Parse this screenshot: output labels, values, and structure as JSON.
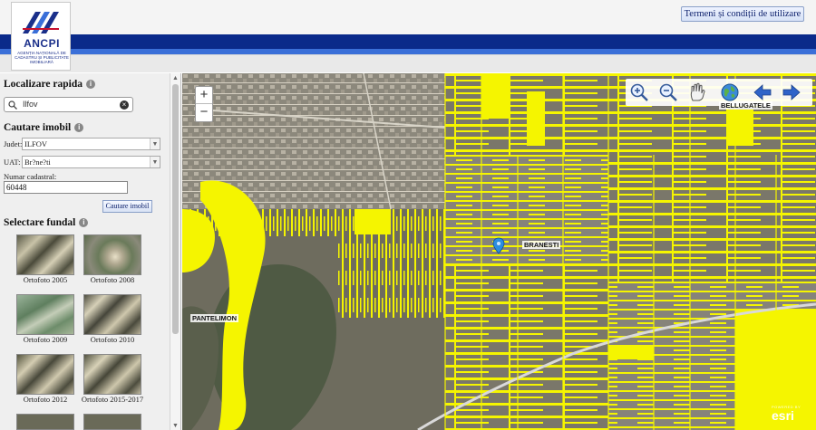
{
  "header": {
    "logo_name": "ANCPI",
    "logo_sub": "AGENȚIA NAȚIONALĂ DE CADASTRU ȘI PUBLICITATE IMOBILIARĂ",
    "terms_label": "Termeni și condiții de utilizare",
    "colors": {
      "band_dark": "#0a2a8a",
      "band_light": "#3a6fd8"
    }
  },
  "sidebar": {
    "quick_locate": {
      "title": "Localizare rapida",
      "search_value": "Ilfov"
    },
    "property_search": {
      "title": "Cautare imobil",
      "county_label": "Judet:",
      "county_value": "ILFOV",
      "uat_label": "UAT:",
      "uat_value": "Br?ne?ti",
      "cadastral_label": "Numar cadastral:",
      "cadastral_value": "60448",
      "search_button": "Cautare imobil"
    },
    "basemap": {
      "title": "Selectare fundal",
      "items": [
        {
          "label": "Ortofoto 2005"
        },
        {
          "label": "Ortofoto 2008"
        },
        {
          "label": "Ortofoto 2009"
        },
        {
          "label": "Ortofoto 2010"
        },
        {
          "label": "Ortofoto 2012"
        },
        {
          "label": "Ortofoto 2015-2017"
        }
      ]
    }
  },
  "map": {
    "places": [
      "BELLUGATELE",
      "BRANESTI",
      "PANTELIMON"
    ],
    "attribution": {
      "powered_by": "POWERED BY",
      "brand": "esri"
    },
    "toolbar_icons": [
      "zoom-in-icon",
      "zoom-out-icon",
      "pan-hand-icon",
      "globe-icon",
      "arrow-left-icon",
      "arrow-right-icon"
    ],
    "colors": {
      "parcel": "#f5f500",
      "imagery": "#6e6c5e"
    }
  }
}
